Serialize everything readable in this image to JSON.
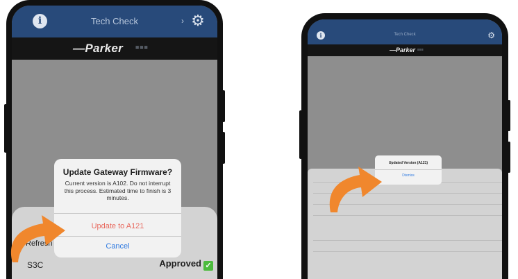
{
  "colors": {
    "header": "#284a7a",
    "brand_bar": "#151515",
    "screen_dim": "#8e8e8e",
    "dialog_bg": "#f2f2f2",
    "destructive_action": "#e86a5f",
    "action_blue": "#2f7ae0",
    "arrow": "#f0872d",
    "approved_check": "#4cbb3c"
  },
  "left_phone": {
    "header": {
      "title": "Tech Check",
      "info_icon": "info-icon",
      "settings_icon": "gear-icon"
    },
    "brand": {
      "logo": "Parker",
      "logo_mark": "≡≡≡"
    },
    "alert": {
      "title": "Update Gateway Firmware?",
      "message": "Current version is A102. Do not interrupt this process. Estimated time to finish is 3 minutes.",
      "primary_action": "Update to A121",
      "cancel_action": "Cancel"
    },
    "sheet": {
      "partial_label": "Refresh",
      "row_label": "S3C",
      "status": "Approved",
      "status_icon": "check-icon"
    }
  },
  "right_phone": {
    "header": {
      "title": "Tech Check",
      "info_icon": "info-icon",
      "settings_icon": "gear-icon"
    },
    "brand": {
      "logo": "Parker",
      "logo_mark": "≡≡≡"
    },
    "alert": {
      "title": "Updated Version (A121)",
      "action": "Dismiss"
    }
  }
}
